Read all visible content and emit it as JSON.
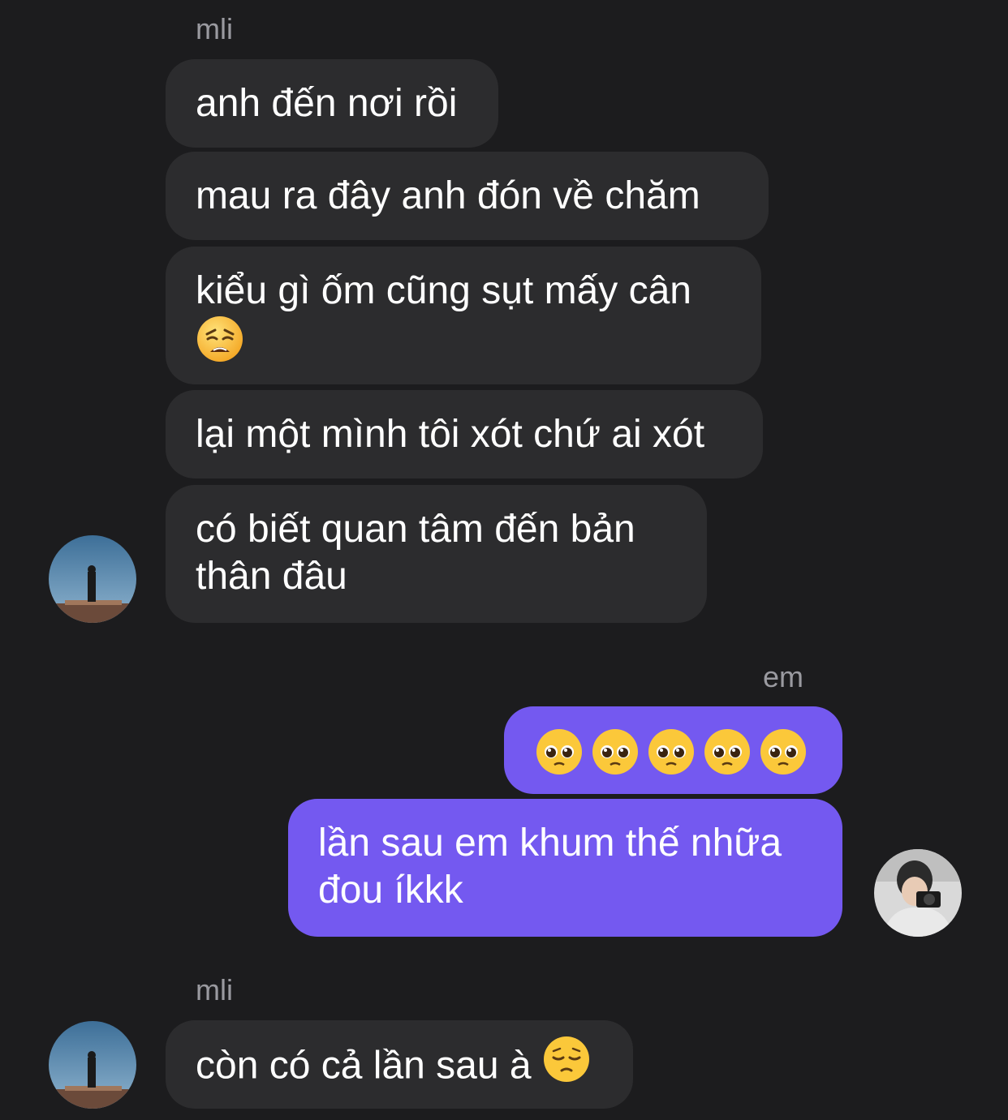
{
  "thread": {
    "group1": {
      "sender": "mli",
      "messages": [
        "anh đến nơi rồi",
        "mau ra đây anh đón về chăm",
        "kiểu gì ốm cũng sụt mấy cân",
        "lại một mình tôi xót chứ ai xót",
        "có biết quan tâm đến bản thân đâu"
      ],
      "msg3_emoji": "weary-face"
    },
    "group2": {
      "sender": "em",
      "msg1_emojis": [
        "pleading-face",
        "pleading-face",
        "pleading-face",
        "pleading-face",
        "pleading-face"
      ],
      "messages": [
        "lần sau em khum thế nhữa đou íkkk"
      ]
    },
    "group3": {
      "sender": "mli",
      "messages": [
        "còn có cả lần sau à"
      ],
      "msg1_emoji": "pensive-face"
    }
  },
  "colors": {
    "background": "#1c1c1e",
    "incoming_bubble": "#2c2c2e",
    "outgoing_bubble": "#7459f0",
    "sender_label": "#9a9aa0"
  }
}
